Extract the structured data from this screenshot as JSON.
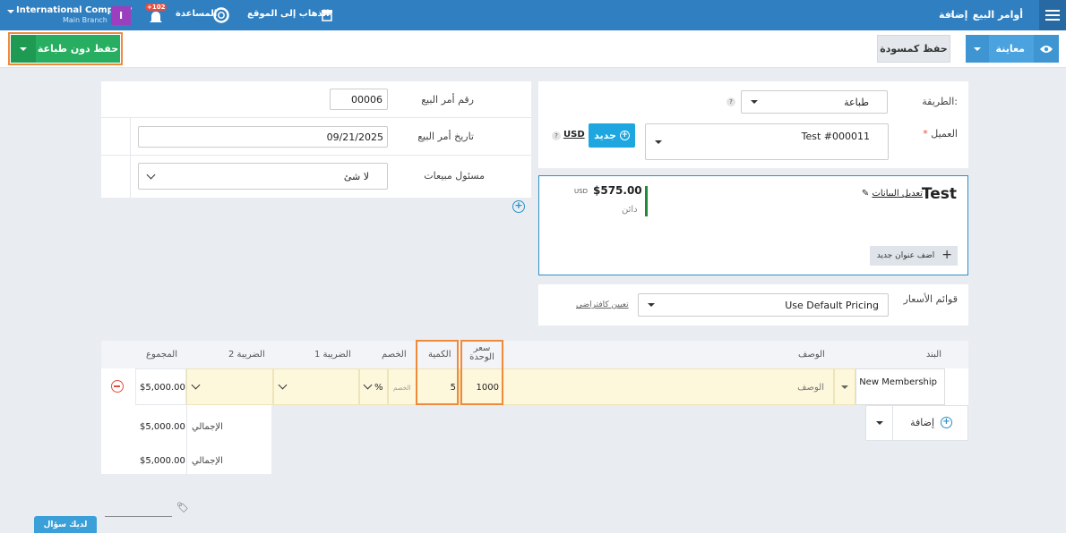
{
  "header": {
    "breadcrumb_parent": "أوامر البيع",
    "breadcrumb_current": "إضافة",
    "go_to_site": "الذهاب إلى الموقع",
    "help": "المساعدة",
    "notifications_badge": "+102",
    "user_initial": "I",
    "company_name": "International Company",
    "branch_name": "Main Branch"
  },
  "toolbar": {
    "preview_label": "معاينة",
    "save_draft_label": "حفظ كمسودة",
    "save_no_print_label": "حفظ دون طباعة"
  },
  "form_left": {
    "method_label": "الطريقة:",
    "method_value": "طباعة",
    "client_label": "العميل",
    "client_required": "*",
    "client_value": "Test #000011",
    "new_client_label": "جديد",
    "currency": "USD",
    "price_list_label": "قوائم الأسعار",
    "price_list_value": "Use Default Pricing",
    "set_default_link": "تعيين كافتراضي"
  },
  "client_card": {
    "name": "Test",
    "edit_link": "تعديل البيانات",
    "balance": "$575.00",
    "balance_currency": "USD",
    "balance_status": "دائن",
    "add_address_label": "اضف عنوان جديد"
  },
  "form_right": {
    "order_number_label": "رقم أمر البيع",
    "order_number_value": "00006",
    "order_date_label": "تاريخ أمر البيع",
    "order_date_value": "09/21/2025",
    "sales_rep_label": "مسئول مبيعات",
    "sales_rep_value": "لا شئ"
  },
  "items_table": {
    "headers": {
      "item": "البند",
      "description": "الوصف",
      "unit_price": "سعر الوحدة",
      "quantity": "الكمية",
      "discount": "الخصم",
      "tax1": "الضريبة 1",
      "tax2": "الضريبة 2",
      "total": "المجموع"
    },
    "rows": [
      {
        "item": "New Membership",
        "description_placeholder": "الوصف",
        "unit_price": "1000",
        "quantity": "5",
        "discount_placeholder": "الخصم",
        "discount_type": "%",
        "total": "$5,000.00"
      }
    ],
    "add_label": "إضافة",
    "subtotal_label": "الإجمالي",
    "subtotal_value": "$5,000.00",
    "grand_total_label": "الإجمالي",
    "grand_total_value": "$5,000.00"
  },
  "footer": {
    "question_label": "لديك سؤال"
  },
  "colors": {
    "primary": "#2f7fc1",
    "save_green": "#27ae60",
    "highlight_orange": "#f08a3b",
    "row_yellow": "#fdf8dc",
    "client_border": "#2d8fc4"
  }
}
